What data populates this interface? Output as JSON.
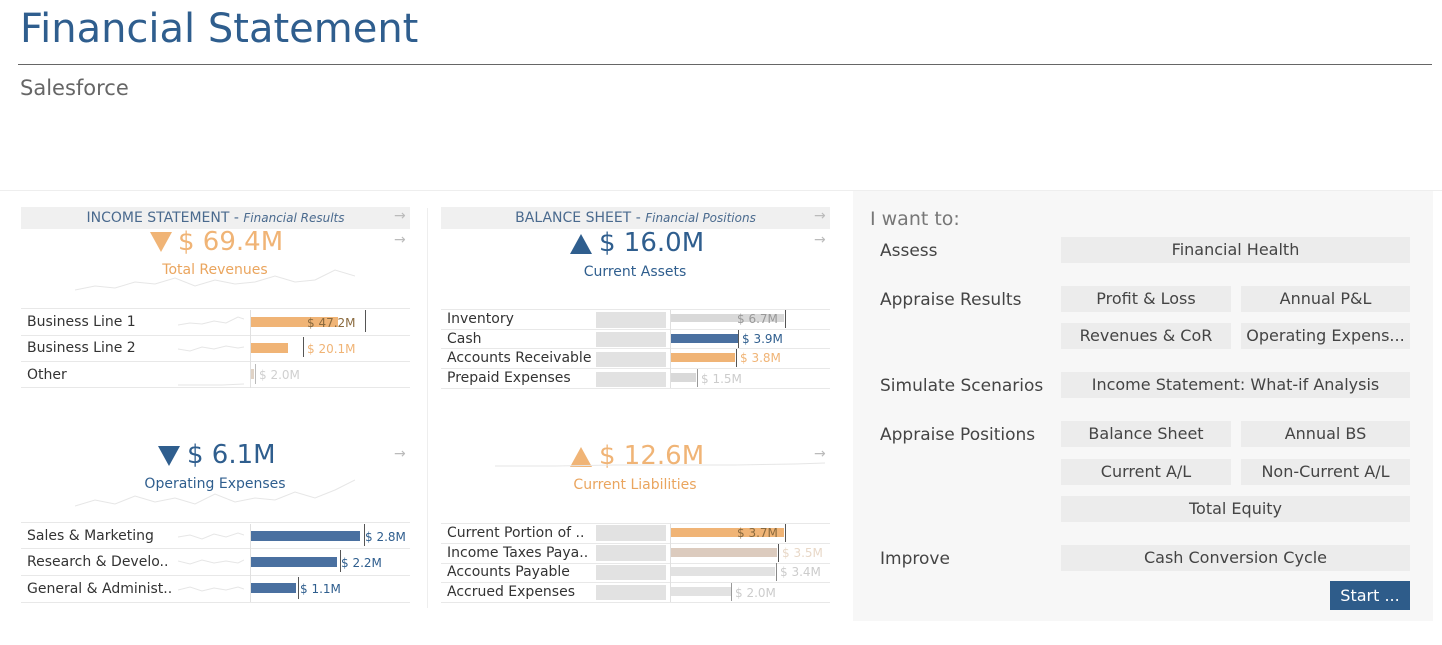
{
  "header": {
    "title": "Financial Statement",
    "subtitle": "Salesforce"
  },
  "colors": {
    "blue": "#2f5e8e",
    "orange": "#f0b476",
    "orange_text": "#eaa55e",
    "beige": "#dccbbe",
    "grey_bar": "#d9d9d9"
  },
  "income": {
    "section_title": "INCOME STATEMENT",
    "section_sub": "Financial Results",
    "revenues": {
      "value": "$ 69.4M",
      "label": "Total Revenues",
      "trend": "down",
      "rows": [
        {
          "label": "Business Line 1",
          "value": "$ 47.2M",
          "bar_share": 0.79
        },
        {
          "label": "Business Line 2",
          "value": "$ 20.1M",
          "bar_share": 0.34
        },
        {
          "label": "Other",
          "value": "$ 2.0M",
          "bar_share": 0.03
        }
      ]
    },
    "opex": {
      "value": "$ 6.1M",
      "label": "Operating Expenses",
      "trend": "down",
      "rows": [
        {
          "label": "Sales & Marketing",
          "value": "$ 2.8M",
          "bar_share": 1.0
        },
        {
          "label": "Research & Develo..",
          "value": "$ 2.2M",
          "bar_share": 0.79
        },
        {
          "label": "General & Administ..",
          "value": "$ 1.1M",
          "bar_share": 0.41
        }
      ]
    }
  },
  "balance": {
    "section_title": "BALANCE SHEET",
    "section_sub": "Financial Positions",
    "assets": {
      "value": "$ 16.0M",
      "label": "Current Assets",
      "trend": "up",
      "rows": [
        {
          "label": "Inventory",
          "value": "$ 6.7M",
          "bar_share": 1.0
        },
        {
          "label": "Cash",
          "value": "$ 3.9M",
          "bar_share": 0.59
        },
        {
          "label": "Accounts Receivable",
          "value": "$ 3.8M",
          "bar_share": 0.57
        },
        {
          "label": "Prepaid Expenses",
          "value": "$ 1.5M",
          "bar_share": 0.22
        }
      ]
    },
    "liabilities": {
      "value": "$ 12.6M",
      "label": "Current Liabilities",
      "trend": "up",
      "rows": [
        {
          "label": "Current Portion of ..",
          "value": "$ 3.7M",
          "bar_share": 1.0
        },
        {
          "label": "Income Taxes Paya..",
          "value": "$ 3.5M",
          "bar_share": 0.94
        },
        {
          "label": "Accounts Payable",
          "value": "$ 3.4M",
          "bar_share": 0.92
        },
        {
          "label": "Accrued Expenses",
          "value": "$ 2.0M",
          "bar_share": 0.54
        }
      ]
    }
  },
  "panel": {
    "title": "I want to:",
    "assess": "Assess",
    "financial_health": "Financial Health",
    "appraise_results": "Appraise Results",
    "profit_loss": "Profit & Loss",
    "annual_pl": "Annual P&L",
    "revenues_cor": "Revenues & CoR",
    "operating_expenses": "Operating Expens...",
    "simulate": "Simulate Scenarios",
    "what_if": "Income Statement: What-if Analysis",
    "appraise_positions": "Appraise Positions",
    "balance_sheet": "Balance Sheet",
    "annual_bs": "Annual BS",
    "current_al": "Current A/L",
    "noncurrent_al": "Non-Current A/L",
    "total_equity": "Total Equity",
    "improve": "Improve",
    "ccc": "Cash Conversion Cycle",
    "start": "Start ..."
  }
}
